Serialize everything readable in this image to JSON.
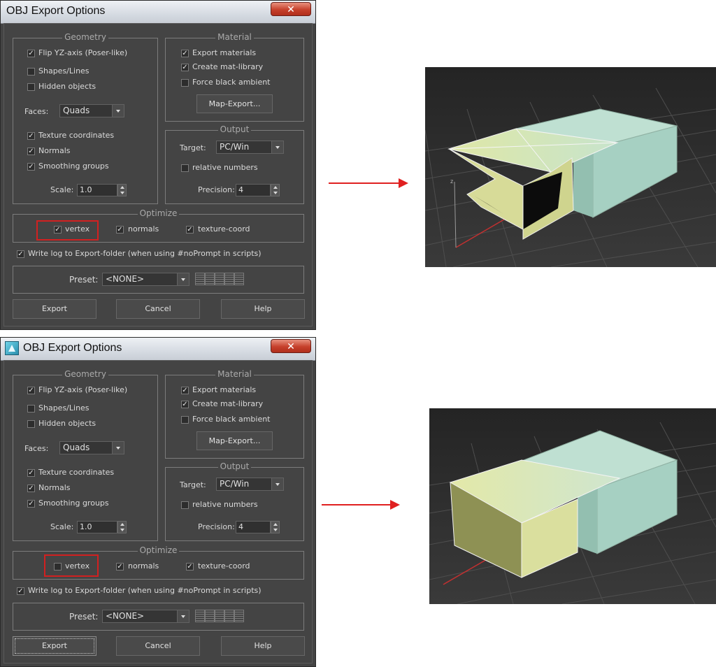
{
  "dialogs": [
    {
      "title": "OBJ Export Options",
      "geometry": {
        "title": "Geometry",
        "flip_yz": {
          "label": "Flip YZ-axis (Poser-like)",
          "checked": true
        },
        "shapes_lines": {
          "label": "Shapes/Lines",
          "checked": false
        },
        "hidden_objects": {
          "label": "Hidden objects",
          "checked": false
        },
        "faces_label": "Faces:",
        "faces_value": "Quads",
        "texture_coords": {
          "label": "Texture coordinates",
          "checked": true
        },
        "normals": {
          "label": "Normals",
          "checked": true
        },
        "smoothing_groups": {
          "label": "Smoothing groups",
          "checked": true
        },
        "scale_label": "Scale:",
        "scale_value": "1.0"
      },
      "material": {
        "title": "Material",
        "export_materials": {
          "label": "Export materials",
          "checked": true
        },
        "create_mat_library": {
          "label": "Create mat-library",
          "checked": true
        },
        "force_black_ambient": {
          "label": "Force black ambient",
          "checked": false
        },
        "map_export_label": "Map-Export..."
      },
      "output": {
        "title": "Output",
        "target_label": "Target:",
        "target_value": "PC/Win",
        "relative_numbers": {
          "label": "relative numbers",
          "checked": false
        },
        "precision_label": "Precision:",
        "precision_value": "4"
      },
      "optimize": {
        "title": "Optimize",
        "vertex": {
          "label": "vertex",
          "checked": true
        },
        "normals": {
          "label": "normals",
          "checked": true
        },
        "texture_coord": {
          "label": "texture-coord",
          "checked": true
        }
      },
      "write_log": {
        "label": "Write log to Export-folder (when using #noPrompt in scripts)",
        "checked": true
      },
      "preset_label": "Preset:",
      "preset_value": "<NONE>",
      "buttons": {
        "export": "Export",
        "cancel": "Cancel",
        "help": "Help"
      }
    },
    {
      "title": "OBJ Export Options",
      "geometry": {
        "title": "Geometry",
        "flip_yz": {
          "label": "Flip YZ-axis (Poser-like)",
          "checked": true
        },
        "shapes_lines": {
          "label": "Shapes/Lines",
          "checked": false
        },
        "hidden_objects": {
          "label": "Hidden objects",
          "checked": false
        },
        "faces_label": "Faces:",
        "faces_value": "Quads",
        "texture_coords": {
          "label": "Texture coordinates",
          "checked": true
        },
        "normals": {
          "label": "Normals",
          "checked": true
        },
        "smoothing_groups": {
          "label": "Smoothing groups",
          "checked": true
        },
        "scale_label": "Scale:",
        "scale_value": "1.0"
      },
      "material": {
        "title": "Material",
        "export_materials": {
          "label": "Export materials",
          "checked": true
        },
        "create_mat_library": {
          "label": "Create mat-library",
          "checked": true
        },
        "force_black_ambient": {
          "label": "Force black ambient",
          "checked": false
        },
        "map_export_label": "Map-Export..."
      },
      "output": {
        "title": "Output",
        "target_label": "Target:",
        "target_value": "PC/Win",
        "relative_numbers": {
          "label": "relative numbers",
          "checked": false
        },
        "precision_label": "Precision:",
        "precision_value": "4"
      },
      "optimize": {
        "title": "Optimize",
        "vertex": {
          "label": "vertex",
          "checked": false
        },
        "normals": {
          "label": "normals",
          "checked": true
        },
        "texture_coord": {
          "label": "texture-coord",
          "checked": true
        }
      },
      "write_log": {
        "label": "Write log to Export-folder (when using #noPrompt in scripts)",
        "checked": true
      },
      "preset_label": "Preset:",
      "preset_value": "<NONE>",
      "buttons": {
        "export": "Export",
        "cancel": "Cancel",
        "help": "Help"
      }
    }
  ],
  "colors": {
    "dialog_bg": "#444444",
    "annotation_red": "#e02020",
    "viewport_bg": "#333333",
    "mesh_yellow": "#e2e6a8",
    "mesh_teal": "#a8d6c8"
  },
  "icons": {
    "close": "close-icon",
    "app": "3dsmax-app-icon",
    "dropdown": "chevron-down-icon"
  }
}
